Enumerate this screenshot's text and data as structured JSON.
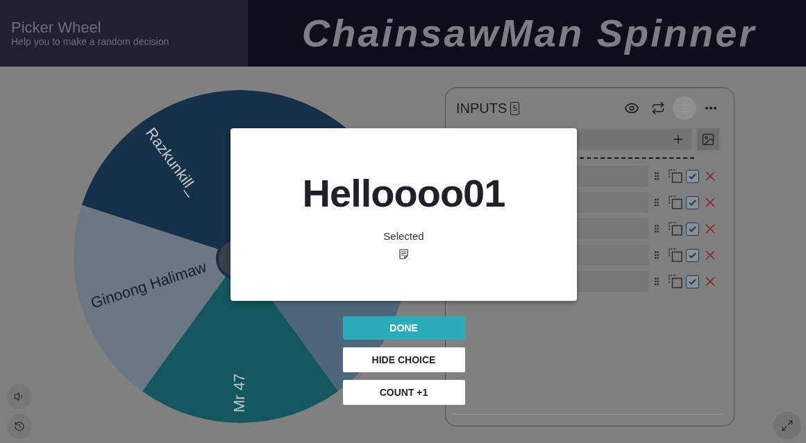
{
  "header": {
    "title": "Picker Wheel",
    "subtitle": "Help you to make a random decision",
    "logo_text": "ChainsawMan Spinner"
  },
  "wheel": {
    "segments": [
      {
        "label": "Razkunkill_",
        "color": "#163047"
      },
      {
        "color": "#163047"
      },
      {
        "color": "#4e667a"
      },
      {
        "label": "Mr 47",
        "color": "#14565d"
      },
      {
        "label": "Ginoong Halimaw",
        "color": "#6b7782"
      }
    ]
  },
  "inputs": {
    "title": "INPUTS",
    "count": "5",
    "list_view_on": true,
    "rows": [
      {
        "checked": true
      },
      {
        "checked": true
      },
      {
        "checked": true
      },
      {
        "checked": true
      },
      {
        "checked": true
      }
    ]
  },
  "result_dialog": {
    "choice": "Helloooo01",
    "caption": "Selected"
  },
  "actions": [
    {
      "label": "DONE",
      "kind": "primary"
    },
    {
      "label": "HIDE CHOICE",
      "kind": "secondary"
    },
    {
      "label": "COUNT +1",
      "kind": "secondary"
    }
  ]
}
